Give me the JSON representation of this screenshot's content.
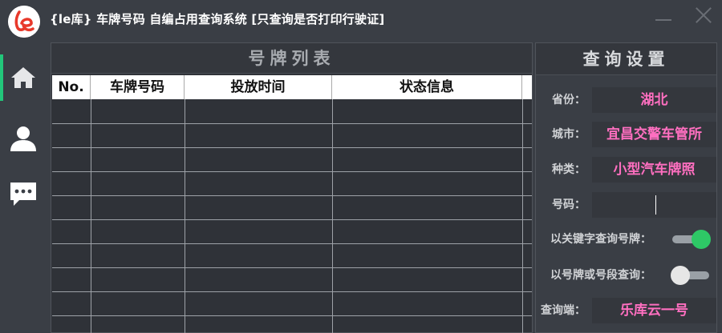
{
  "window": {
    "title": "{le库} 车牌号码 自编占用查询系统  [只查询是否打印行驶证]"
  },
  "icons": {
    "logo": "le-logo",
    "sidebar": [
      "home-icon",
      "user-icon",
      "message-icon"
    ],
    "window_controls": [
      "minimize-icon",
      "close-icon"
    ]
  },
  "plate_list": {
    "title": "号牌列表",
    "columns": [
      "No.",
      "车牌号码",
      "投放时间",
      "状态信息"
    ],
    "rows": []
  },
  "settings": {
    "title": "查询设置",
    "province": {
      "label": "省份：",
      "value": "湖北"
    },
    "city": {
      "label": "城市：",
      "value": "宜昌交警车管所"
    },
    "type": {
      "label": "种类：",
      "value": "小型汽车牌照"
    },
    "number": {
      "label": "号码：",
      "value": ""
    },
    "keyword_query": {
      "label": "以关键字查询号牌：",
      "enabled": true
    },
    "segment_query": {
      "label": "以号牌或号段查询：",
      "enabled": false
    },
    "endpoint": {
      "label": "查询端：",
      "value": "乐库云一号"
    }
  },
  "colors": {
    "accent_green": "#2ec866",
    "value_pink": "#ff6fc0",
    "background": "#3a3e45"
  }
}
